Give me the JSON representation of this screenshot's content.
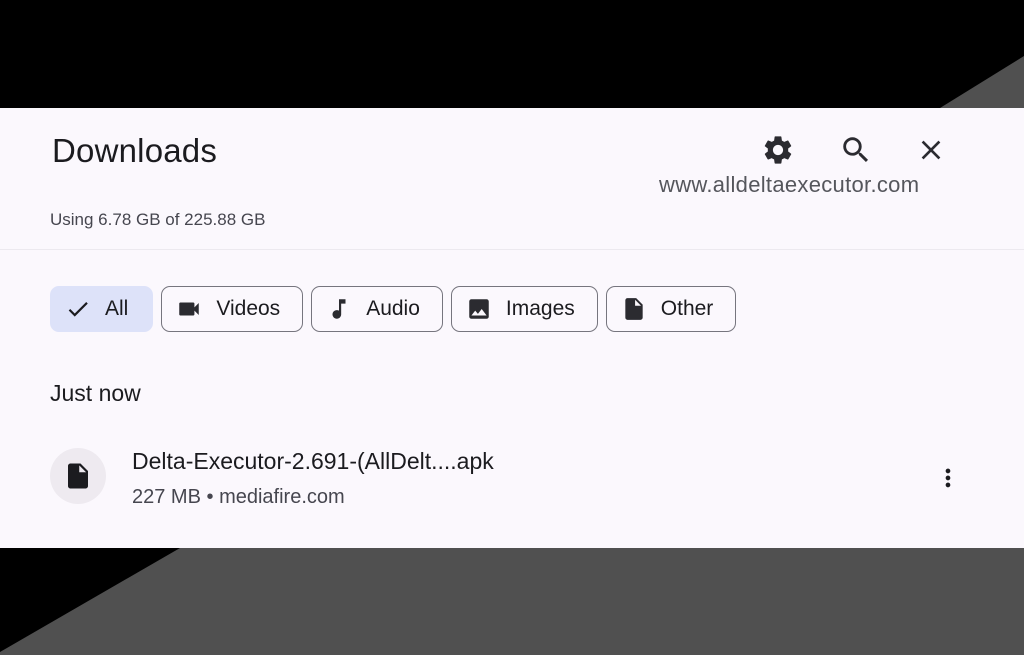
{
  "header": {
    "title": "Downloads",
    "settings_icon": "gear-icon",
    "search_icon": "search-icon",
    "close_icon": "close-icon"
  },
  "watermark": "www.alldeltaexecutor.com",
  "storage_text": "Using 6.78 GB of 225.88 GB",
  "filters": [
    {
      "label": "All",
      "icon": "check-icon",
      "selected": true
    },
    {
      "label": "Videos",
      "icon": "videocam-icon",
      "selected": false
    },
    {
      "label": "Audio",
      "icon": "music-note-icon",
      "selected": false
    },
    {
      "label": "Images",
      "icon": "image-icon",
      "selected": false
    },
    {
      "label": "Other",
      "icon": "file-icon",
      "selected": false
    }
  ],
  "section": {
    "label": "Just now"
  },
  "downloads": [
    {
      "name": "Delta-Executor-2.691-(AllDelt....apk",
      "size": "227 MB",
      "separator": "•",
      "source": "mediafire.com",
      "icon": "file-icon"
    }
  ],
  "colors": {
    "panel_bg": "#fbf8fd",
    "chip_selected_bg": "#dde2f9",
    "text_primary": "#1b1b1f",
    "text_secondary": "#46464f"
  }
}
